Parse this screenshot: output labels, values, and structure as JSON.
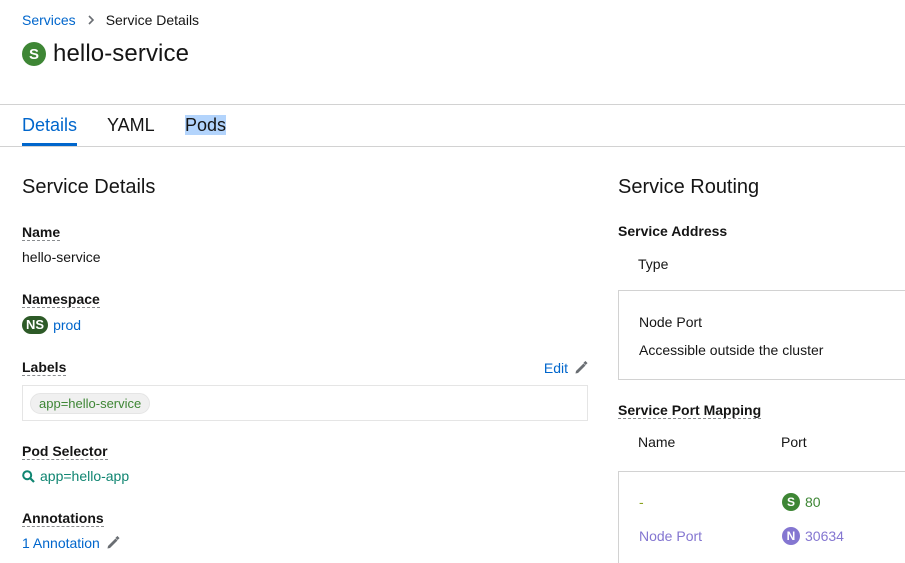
{
  "breadcrumb": {
    "parent": "Services",
    "separator": ">",
    "current": "Service Details"
  },
  "header": {
    "badge": "S",
    "title": "hello-service"
  },
  "tabs": [
    {
      "label": "Details",
      "active": true
    },
    {
      "label": "YAML",
      "active": false
    },
    {
      "label": "Pods",
      "active": false
    }
  ],
  "details": {
    "heading": "Service Details",
    "name_label": "Name",
    "name_value": "hello-service",
    "namespace_label": "Namespace",
    "namespace_badge": "NS",
    "namespace_value": "prod",
    "labels_label": "Labels",
    "labels_edit": "Edit",
    "labels": [
      "app=hello-service"
    ],
    "selector_label": "Pod Selector",
    "selector_value": "app=hello-app",
    "annotations_label": "Annotations",
    "annotations_value": "1 Annotation"
  },
  "routing": {
    "heading": "Service Routing",
    "address_label": "Service Address",
    "address_col": "Type",
    "address_type": "Node Port",
    "address_desc": "Accessible outside the cluster",
    "mapping_label": "Service Port Mapping",
    "mapping_cols": {
      "name": "Name",
      "port": "Port"
    },
    "mapping_rows": [
      {
        "name": "-",
        "badge": "S",
        "port": "80"
      },
      {
        "name": "Node Port",
        "badge": "N",
        "port": "30634"
      }
    ]
  },
  "colors": {
    "link": "#0066cc",
    "service_badge": "#3e8635",
    "namespace_badge": "#2d5a27",
    "node_badge": "#8476d1",
    "selector": "#0f8571"
  },
  "icons": [
    "chevron-right-icon",
    "pencil-icon",
    "search-icon"
  ]
}
